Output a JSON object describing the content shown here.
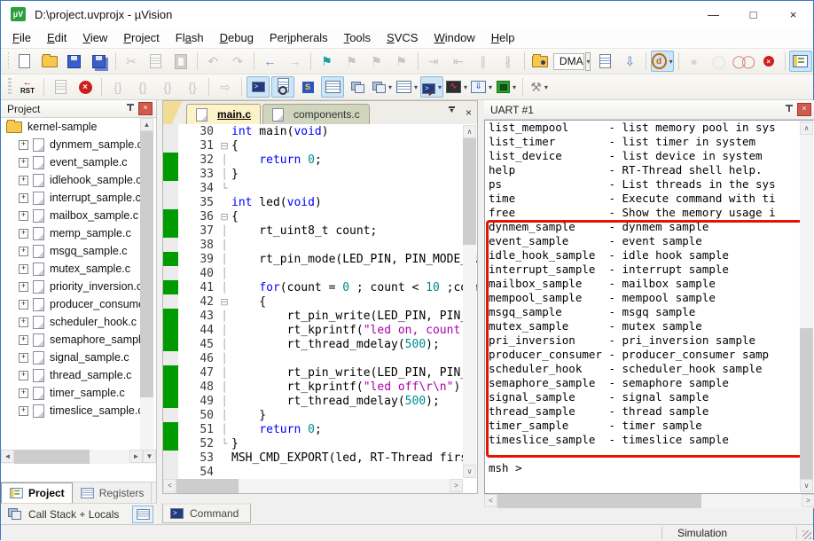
{
  "window": {
    "title": "D:\\project.uvprojx - µVision",
    "controls": {
      "minimize": "—",
      "maximize": "□",
      "close": "×"
    }
  },
  "icons": {
    "close_glyph": "×",
    "tab_close": "×",
    "tab_list": "▼",
    "scroll": {
      "up": "▲",
      "down": "▼",
      "left": "◄",
      "right": "►",
      "up2": "∧",
      "down2": "∨",
      "left2": "<",
      "right2": ">"
    }
  },
  "menu": {
    "items": [
      {
        "label": "File",
        "accel": 0
      },
      {
        "label": "Edit",
        "accel": 0
      },
      {
        "label": "View",
        "accel": 0
      },
      {
        "label": "Project",
        "accel": 0
      },
      {
        "label": "Flash",
        "accel": 2
      },
      {
        "label": "Debug",
        "accel": 0
      },
      {
        "label": "Peripherals",
        "accel": 3
      },
      {
        "label": "Tools",
        "accel": 0
      },
      {
        "label": "SVCS",
        "accel": 0
      },
      {
        "label": "Window",
        "accel": 0
      },
      {
        "label": "Help",
        "accel": 0
      }
    ]
  },
  "toolbar1": [
    {
      "n": "new-file-button",
      "k": "doc"
    },
    {
      "n": "open-file-button",
      "k": "folder"
    },
    {
      "n": "save-button",
      "k": "disk"
    },
    {
      "n": "save-all-button",
      "k": "disk2"
    },
    {
      "sep": true
    },
    {
      "n": "cut-button",
      "k": "g",
      "g": "✂",
      "dis": 1
    },
    {
      "n": "copy-button",
      "k": "doc2",
      "dis": 1
    },
    {
      "n": "paste-button",
      "k": "paste",
      "dis": 1
    },
    {
      "sep": true
    },
    {
      "n": "undo-button",
      "k": "g",
      "g": "↶",
      "c": "#8a7ab8",
      "dis": 1
    },
    {
      "n": "redo-button",
      "k": "g",
      "g": "↷",
      "c": "#8a7ab8",
      "dis": 1
    },
    {
      "sep": true
    },
    {
      "n": "navigate-back-button",
      "k": "g",
      "g": "←",
      "c": "#5b7fce"
    },
    {
      "n": "navigate-forward-button",
      "k": "g",
      "g": "→",
      "dis": 1
    },
    {
      "sep": true
    },
    {
      "n": "toggle-bookmark-button",
      "k": "g",
      "g": "⚑",
      "c": "#18a0a8"
    },
    {
      "n": "prev-bookmark-button",
      "k": "g",
      "g": "⚑",
      "dis": 1
    },
    {
      "n": "next-bookmark-button",
      "k": "g",
      "g": "⚑",
      "dis": 1
    },
    {
      "n": "clear-bookmarks-button",
      "k": "g",
      "g": "⚑",
      "dis": 1
    },
    {
      "sep": true
    },
    {
      "n": "indent-button",
      "k": "g",
      "g": "⇥",
      "dis": 1
    },
    {
      "n": "outdent-button",
      "k": "g",
      "g": "⇤",
      "dis": 1
    },
    {
      "n": "comment-button",
      "k": "g",
      "g": "∥",
      "dis": 1
    },
    {
      "n": "uncomment-button",
      "k": "g",
      "g": "∦",
      "dis": 1
    },
    {
      "sep": true
    },
    {
      "n": "find-in-files-button",
      "k": "folder2"
    },
    {
      "n": "search-combo",
      "k": "combo",
      "v": "DMA"
    },
    {
      "n": "combo-dropdown-button",
      "k": "caret"
    },
    {
      "n": "find-in-document-button",
      "k": "doc2"
    },
    {
      "n": "incremental-find-button",
      "k": "g",
      "g": "⇩",
      "c": "#4f7fd0"
    },
    {
      "sep": true
    },
    {
      "n": "find-button",
      "k": "findd",
      "on": 1,
      "dd": 1
    },
    {
      "sep": true
    },
    {
      "n": "insert-breakpoint-button",
      "k": "g",
      "g": "●",
      "c": "#b4b4b4",
      "dis": 1
    },
    {
      "n": "enable-breakpoint-button",
      "k": "g",
      "g": "◯",
      "c": "#c0c0c0",
      "dis": 1
    },
    {
      "n": "disable-all-breakpoints-button",
      "k": "bp2"
    },
    {
      "n": "kill-all-breakpoints-button",
      "k": "bpkill"
    },
    {
      "sep": true
    },
    {
      "n": "project-window-button",
      "k": "winico",
      "on": 1
    }
  ],
  "toolbar2": [
    {
      "n": "reset-button",
      "k": "rst",
      "g": "RST"
    },
    {
      "sep": true
    },
    {
      "n": "run-button",
      "k": "doc2",
      "dis": 1
    },
    {
      "n": "stop-button",
      "k": "stop"
    },
    {
      "sep": true
    },
    {
      "n": "step-button",
      "k": "g",
      "g": "{}",
      "dis": 1
    },
    {
      "n": "step-over-button",
      "k": "g",
      "g": "{}",
      "dis": 1
    },
    {
      "n": "step-out-button",
      "k": "g",
      "g": "{}",
      "dis": 1
    },
    {
      "n": "run-to-cursor-button",
      "k": "g",
      "g": "{}",
      "dis": 1
    },
    {
      "sep": true
    },
    {
      "n": "goto-button",
      "k": "g",
      "g": "⇨",
      "dis": 1
    },
    {
      "sep": true
    },
    {
      "n": "command-window-button",
      "k": "term",
      "on": 1
    },
    {
      "n": "disassembly-window-button",
      "k": "docmag",
      "on": 1
    },
    {
      "n": "symbol-window-button",
      "k": "smb"
    },
    {
      "n": "registers-window-button",
      "k": "grid",
      "on": 1
    },
    {
      "n": "call-stack-window-button",
      "k": "stack"
    },
    {
      "n": "watch-window-button",
      "k": "stack",
      "dd": 1
    },
    {
      "n": "memory-window-button",
      "k": "grid",
      "dd": 1
    },
    {
      "n": "serial-window-button",
      "k": "serial",
      "on": 1,
      "dd": 1
    },
    {
      "n": "analysis-window-button",
      "k": "wave",
      "dd": 1
    },
    {
      "n": "trace-window-button",
      "k": "trace",
      "dd": 1
    },
    {
      "n": "system-viewer-button",
      "k": "chip",
      "dd": 1
    },
    {
      "sep": true
    },
    {
      "n": "toolbox-button",
      "k": "g",
      "g": "⚒",
      "c": "#888888",
      "dd": 1
    }
  ],
  "project": {
    "title": "Project",
    "root": "kernel-sample",
    "files": [
      "dynmem_sample.c",
      "event_sample.c",
      "idlehook_sample.c",
      "interrupt_sample.c",
      "mailbox_sample.c",
      "memp_sample.c",
      "msgq_sample.c",
      "mutex_sample.c",
      "priority_inversion.c",
      "producer_consumer",
      "scheduler_hook.c",
      "semaphore_sample.",
      "signal_sample.c",
      "thread_sample.c",
      "timer_sample.c",
      "timeslice_sample.c"
    ],
    "tabs": [
      "Project",
      "Registers"
    ]
  },
  "editor": {
    "tabs": [
      {
        "label": "main.c"
      },
      {
        "label": "components.c"
      }
    ],
    "lines": [
      {
        "no": "30",
        "f": "",
        "cov": 0,
        "seg": [
          [
            "tk",
            "int"
          ],
          [
            "ct",
            " main("
          ],
          [
            "tk",
            "void"
          ],
          [
            "ct",
            ")"
          ]
        ]
      },
      {
        "no": "31",
        "f": "⊟",
        "cov": 0,
        "seg": [
          [
            "ct",
            "{"
          ]
        ]
      },
      {
        "no": "32",
        "f": "│",
        "cov": 1,
        "seg": [
          [
            "ct",
            "    "
          ],
          [
            "tk",
            "return"
          ],
          [
            "ct",
            " "
          ],
          [
            "tn",
            "0"
          ],
          [
            "ct",
            ";"
          ]
        ]
      },
      {
        "no": "33",
        "f": "│",
        "cov": 1,
        "seg": [
          [
            "ct",
            "}"
          ]
        ]
      },
      {
        "no": "34",
        "f": "└",
        "cov": 0,
        "seg": []
      },
      {
        "no": "35",
        "f": "",
        "cov": 0,
        "seg": [
          [
            "tk",
            "int"
          ],
          [
            "ct",
            " led("
          ],
          [
            "tk",
            "void"
          ],
          [
            "ct",
            ")"
          ]
        ]
      },
      {
        "no": "36",
        "f": "⊟",
        "cov": 1,
        "seg": [
          [
            "ct",
            "{"
          ]
        ]
      },
      {
        "no": "37",
        "f": "│",
        "cov": 1,
        "seg": [
          [
            "ct",
            "    rt_uint8_t count;"
          ]
        ]
      },
      {
        "no": "38",
        "f": "│",
        "cov": 0,
        "seg": []
      },
      {
        "no": "39",
        "f": "│",
        "cov": 1,
        "seg": [
          [
            "ct",
            "    rt_pin_mode(LED_PIN, PIN_MODE_OU"
          ]
        ]
      },
      {
        "no": "40",
        "f": "│",
        "cov": 0,
        "seg": []
      },
      {
        "no": "41",
        "f": "│",
        "cov": 1,
        "seg": [
          [
            "ct",
            "    "
          ],
          [
            "tk",
            "for"
          ],
          [
            "ct",
            "(count = "
          ],
          [
            "tn",
            "0"
          ],
          [
            "ct",
            " ; count < "
          ],
          [
            "tn",
            "10"
          ],
          [
            "ct",
            " ;coun"
          ]
        ]
      },
      {
        "no": "42",
        "f": "⊟",
        "cov": 0,
        "seg": [
          [
            "ct",
            "    {"
          ]
        ]
      },
      {
        "no": "43",
        "f": "│",
        "cov": 1,
        "seg": [
          [
            "ct",
            "        rt_pin_write(LED_PIN, PIN_"
          ]
        ]
      },
      {
        "no": "44",
        "f": "│",
        "cov": 1,
        "seg": [
          [
            "ct",
            "        rt_kprintf("
          ],
          [
            "ts",
            "\"led on, count"
          ]
        ]
      },
      {
        "no": "45",
        "f": "│",
        "cov": 1,
        "seg": [
          [
            "ct",
            "        rt_thread_mdelay("
          ],
          [
            "tn",
            "500"
          ],
          [
            "ct",
            ");"
          ]
        ]
      },
      {
        "no": "46",
        "f": "│",
        "cov": 0,
        "seg": []
      },
      {
        "no": "47",
        "f": "│",
        "cov": 1,
        "seg": [
          [
            "ct",
            "        rt_pin_write(LED_PIN, PIN_"
          ]
        ]
      },
      {
        "no": "48",
        "f": "│",
        "cov": 1,
        "seg": [
          [
            "ct",
            "        rt_kprintf("
          ],
          [
            "ts",
            "\"led off\\r\\n\""
          ],
          [
            "ct",
            ");"
          ]
        ]
      },
      {
        "no": "49",
        "f": "│",
        "cov": 1,
        "seg": [
          [
            "ct",
            "        rt_thread_mdelay("
          ],
          [
            "tn",
            "500"
          ],
          [
            "ct",
            ");"
          ]
        ]
      },
      {
        "no": "50",
        "f": "│",
        "cov": 0,
        "seg": [
          [
            "ct",
            "    }"
          ]
        ]
      },
      {
        "no": "51",
        "f": "│",
        "cov": 1,
        "seg": [
          [
            "ct",
            "    "
          ],
          [
            "tk",
            "return"
          ],
          [
            "ct",
            " "
          ],
          [
            "tn",
            "0"
          ],
          [
            "ct",
            ";"
          ]
        ]
      },
      {
        "no": "52",
        "f": "└",
        "cov": 1,
        "seg": [
          [
            "ct",
            "}"
          ]
        ]
      },
      {
        "no": "53",
        "f": "",
        "cov": 0,
        "seg": [
          [
            "ct",
            "MSH_CMD_EXPORT(led, RT-Thread firs"
          ]
        ]
      },
      {
        "no": "54",
        "f": "",
        "cov": 0,
        "seg": []
      }
    ]
  },
  "uart": {
    "title": "UART #1",
    "highlight_color": "#e41400",
    "lines": [
      "list_mempool      - list memory pool in sys",
      "list_timer        - list timer in system",
      "list_device       - list device in system",
      "help              - RT-Thread shell help.",
      "ps                - List threads in the sys",
      "time              - Execute command with ti",
      "free              - Show the memory usage i",
      "dynmem_sample     - dynmem sample",
      "event_sample      - event sample",
      "idle_hook_sample  - idle hook sample",
      "interrupt_sample  - interrupt sample",
      "mailbox_sample    - mailbox sample",
      "mempool_sample    - mempool sample",
      "msgq_sample       - msgq sample",
      "mutex_sample      - mutex sample",
      "pri_inversion     - pri_inversion sample",
      "producer_consumer - producer_consumer samp",
      "scheduler_hook    - scheduler_hook sample",
      "semaphore_sample  - semaphore sample",
      "signal_sample     - signal sample",
      "thread_sample     - thread sample",
      "timer_sample      - timer sample",
      "timeslice_sample  - timeslice sample",
      "",
      "msh >"
    ]
  },
  "bottom": {
    "call_stack_label": "Call Stack + Locals",
    "command_label": "Command"
  },
  "status": {
    "right_text": "Simulation"
  }
}
